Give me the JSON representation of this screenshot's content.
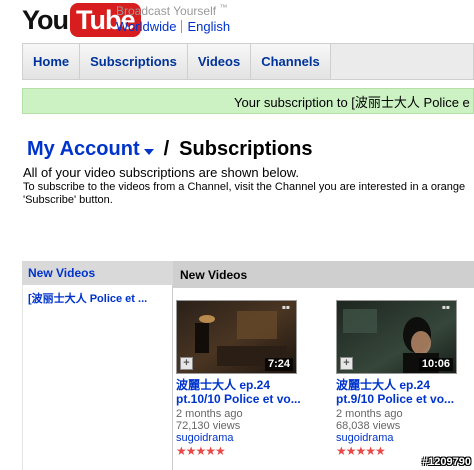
{
  "header": {
    "logo_you": "You",
    "logo_tube": "Tube",
    "tagline": "Broadcast Yourself",
    "tagline_mark": "™",
    "region": "Worldwide",
    "language": "English"
  },
  "nav": {
    "tabs": [
      {
        "label": "Home"
      },
      {
        "label": "Subscriptions"
      },
      {
        "label": "Videos"
      },
      {
        "label": "Channels"
      }
    ]
  },
  "confirmation": {
    "text": "Your subscription to [波丽士大人 Police e"
  },
  "page": {
    "account_label": "My Account",
    "separator": "/",
    "title": "Subscriptions",
    "intro_line1": "All of your video subscriptions are shown below.",
    "intro_line2": "To subscribe to the videos from a Channel, visit the Channel you are interested in a orange 'Subscribe' button."
  },
  "sidebar": {
    "heading": "New Videos",
    "items": [
      {
        "label": "[波丽士大人 Police et ..."
      }
    ]
  },
  "main": {
    "heading": "New Videos",
    "videos": [
      {
        "title_line1": "波麗士大人 ep.24",
        "title_line2": "pt.10/10 Police et vo...",
        "age": "2 months ago",
        "views": "72,130 views",
        "author": "sugoidrama",
        "duration": "7:24",
        "stars": "★★★★★"
      },
      {
        "title_line1": "波麗士大人 ep.24",
        "title_line2": "pt.9/10 Police et vo...",
        "age": "2 months ago",
        "views": "68,038 views",
        "author": "sugoidrama",
        "duration": "10:06",
        "stars": "★★★★★"
      }
    ]
  },
  "watermark": "#1209790",
  "colors": {
    "link_blue": "#0033cc",
    "brand_red": "#d71d1d",
    "confirm_green": "#ccf2c4",
    "star_red": "#e84848"
  }
}
